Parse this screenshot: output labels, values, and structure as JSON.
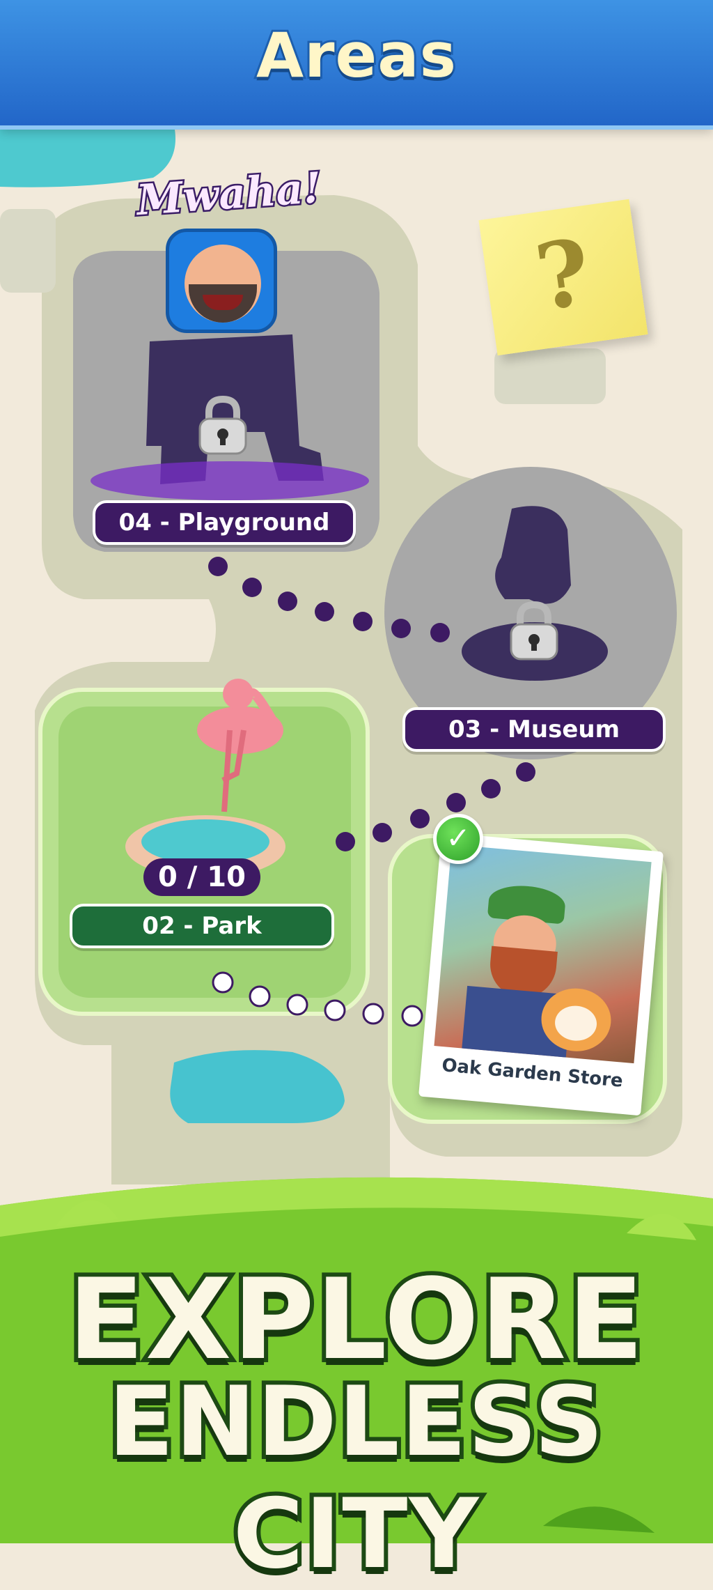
{
  "header": {
    "title": "Areas"
  },
  "areas": [
    {
      "label": "04 - Playground",
      "state": "locked"
    },
    {
      "label": "03 - Museum",
      "state": "locked"
    },
    {
      "label": "02 - Park",
      "state": "active",
      "progress": "0 / 10"
    }
  ],
  "villain_speech": "Mwaha!",
  "mystery_note": "?",
  "completed_area": {
    "caption": "Oak Garden Store",
    "badge": "✓"
  },
  "banner": {
    "line1": "EXPLORE",
    "line2": "ENDLESS CITY"
  },
  "icons": [
    "lock-icon",
    "lock-icon",
    "checkmark-icon",
    "villain-avatar-icon",
    "flamingo-icon"
  ],
  "colors": {
    "header_blue": "#2f7fd8",
    "locked_purple": "#3d1a63",
    "park_green": "#1e6e3a",
    "banner_green": "#6fc42a"
  }
}
